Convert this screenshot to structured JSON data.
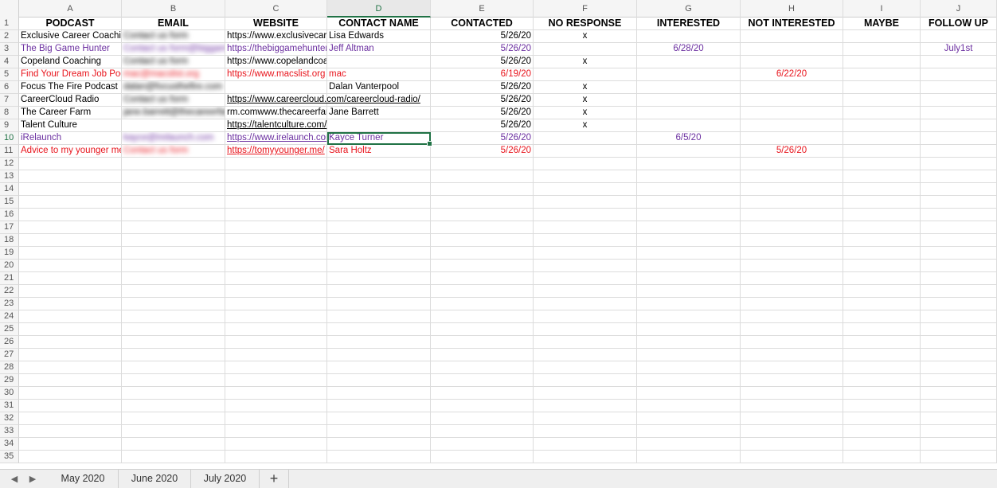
{
  "columns": [
    "A",
    "B",
    "C",
    "D",
    "E",
    "F",
    "G",
    "H",
    "I",
    "J"
  ],
  "active_column": "D",
  "active_row": 10,
  "headers": [
    "PODCAST",
    "EMAIL",
    "WEBSITE",
    "CONTACT NAME",
    "CONTACTED",
    "NO RESPONSE",
    "INTERESTED",
    "NOT INTERESTED",
    "MAYBE",
    "FOLLOW UP"
  ],
  "rows": [
    {
      "podcast": "Exclusive Career Coaching",
      "email": "Contact us form",
      "website": "https://www.exclusivecareercoaching.com",
      "contact": "Lisa Edwards",
      "contacted": "5/26/20",
      "no_response": "x",
      "interested": "",
      "not_interested": "",
      "maybe": "",
      "follow_up": "",
      "style": "black"
    },
    {
      "podcast": "The Big Game Hunter",
      "email": "Contact us form@biggamehunter",
      "website": "https://thebiggamehunter.us",
      "contact": "Jeff Altman",
      "contacted": "5/26/20",
      "no_response": "",
      "interested": "6/28/20",
      "not_interested": "",
      "maybe": "",
      "follow_up": "July1st",
      "style": "purple"
    },
    {
      "podcast": "Copeland Coaching",
      "email": "Contact us form",
      "website": "https://www.copelandcoaching.com/category/podcast",
      "contact": "",
      "contacted": "5/26/20",
      "no_response": "x",
      "interested": "",
      "not_interested": "",
      "maybe": "",
      "follow_up": "",
      "style": "black"
    },
    {
      "podcast": "Find Your Dream Job Podcast",
      "email": "mac@macslist.org",
      "website": "https://www.macslist.org",
      "contact": "mac",
      "contacted": "6/19/20",
      "no_response": "",
      "interested": "",
      "not_interested": "6/22/20",
      "maybe": "",
      "follow_up": "",
      "style": "red"
    },
    {
      "podcast": "Focus The Fire Podcast",
      "email": "dalan@focusthefire.com",
      "website": "",
      "contact": "Dalan Vanterpool",
      "contacted": "5/26/20",
      "no_response": "x",
      "interested": "",
      "not_interested": "",
      "maybe": "",
      "follow_up": "",
      "style": "black"
    },
    {
      "podcast": "CareerCloud Radio",
      "email": "Contact us form",
      "website": "https://www.careercloud.com/careercloud-radio/",
      "contact": "",
      "contacted": "5/26/20",
      "no_response": "x",
      "interested": "",
      "not_interested": "",
      "maybe": "",
      "follow_up": "",
      "style": "black",
      "website_overflow": true,
      "website_link": true
    },
    {
      "podcast": "The Career Farm",
      "email": "jane.barrett@thecareerfarm.com",
      "website": "rm.comwww.thecareerfarm",
      "contact": "Jane Barrett",
      "contacted": "5/26/20",
      "no_response": "x",
      "interested": "",
      "not_interested": "",
      "maybe": "",
      "follow_up": "",
      "style": "black"
    },
    {
      "podcast": "Talent Culture",
      "email": "",
      "website": "https://talentculture.com/",
      "contact": "",
      "contacted": "5/26/20",
      "no_response": "x",
      "interested": "",
      "not_interested": "",
      "maybe": "",
      "follow_up": "",
      "style": "black",
      "website_overflow": true,
      "website_link": true
    },
    {
      "podcast": "iRelaunch",
      "email": "kayce@irelaunch.com",
      "website": "https://www.irelaunch.com",
      "contact": "Kayce Turner",
      "contacted": "5/26/20",
      "no_response": "",
      "interested": "6/5/20",
      "not_interested": "",
      "maybe": "",
      "follow_up": "",
      "style": "purple",
      "website_link": true
    },
    {
      "podcast": "Advice to my younger me",
      "email": "Contact us form",
      "website": "https://tomyyounger.me/",
      "contact": "Sara Holtz",
      "contacted": "5/26/20",
      "no_response": "",
      "interested": "",
      "not_interested": "5/26/20",
      "maybe": "",
      "follow_up": "",
      "style": "red",
      "website_link": true
    }
  ],
  "total_rows": 35,
  "sheet_tabs": [
    {
      "label": "May 2020",
      "active": true
    },
    {
      "label": "June 2020",
      "active": false
    },
    {
      "label": "July 2020",
      "active": false
    }
  ],
  "add_sheet_label": "+",
  "nav": {
    "prev": "◀",
    "next": "▶"
  },
  "colors": {
    "accent": "#207245",
    "purple": "#6b2fa0",
    "red": "#e8141c"
  }
}
